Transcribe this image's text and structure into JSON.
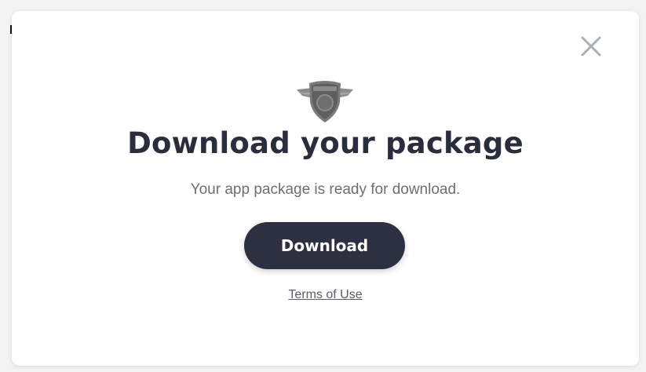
{
  "modal": {
    "title": "Download your package",
    "subtitle": "Your app package is ready for download.",
    "download_label": "Download",
    "terms_label": "Terms of Use",
    "close_icon": "close-icon",
    "logo_icon": "winged-shield-logo"
  },
  "colors": {
    "title": "#2a2d3c",
    "button_bg": "#2c3040",
    "button_text": "#ffffff",
    "close_icon": "#a9b0b8"
  }
}
